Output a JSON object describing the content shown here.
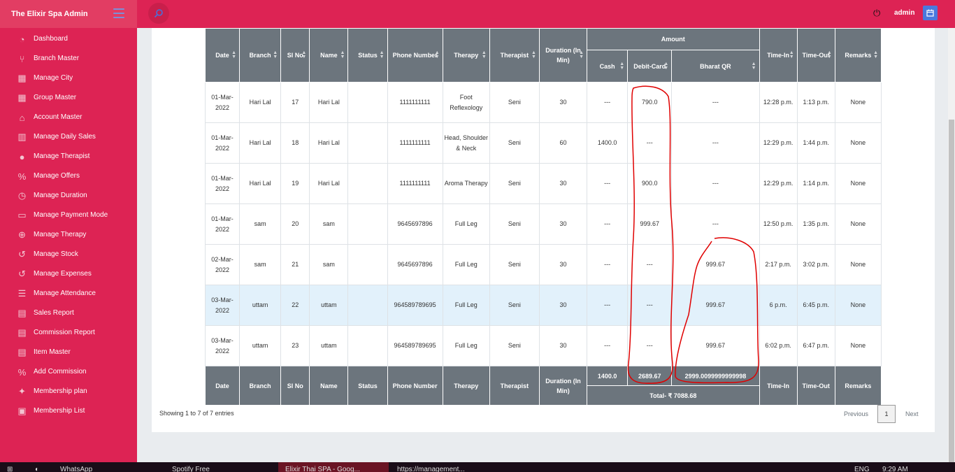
{
  "app": {
    "brand": "The Elixir Spa Admin",
    "user": "admin"
  },
  "colors": {
    "primary": "#dd2354",
    "header_cell": "#6c757d",
    "highlight_row": "#e2f1fb",
    "annotation": "#e00000"
  },
  "sidebar": {
    "items": [
      {
        "label": "Dashboard",
        "icon": "dashboard-icon"
      },
      {
        "label": "Branch Master",
        "icon": "branch-icon"
      },
      {
        "label": "Manage City",
        "icon": "building-icon"
      },
      {
        "label": "Group Master",
        "icon": "building-icon"
      },
      {
        "label": "Account Master",
        "icon": "bank-icon"
      },
      {
        "label": "Manage Daily Sales",
        "icon": "bar-chart-icon"
      },
      {
        "label": "Manage Therapist",
        "icon": "user-icon"
      },
      {
        "label": "Manage Offers",
        "icon": "percent-icon"
      },
      {
        "label": "Manage Duration",
        "icon": "clock-icon"
      },
      {
        "label": "Manage Payment Mode",
        "icon": "money-icon"
      },
      {
        "label": "Manage Therapy",
        "icon": "plus-circle-icon"
      },
      {
        "label": "Manage Stock",
        "icon": "history-icon"
      },
      {
        "label": "Manage Expenses",
        "icon": "history-icon"
      },
      {
        "label": "Manage Attendance",
        "icon": "list-icon"
      },
      {
        "label": "Sales Report",
        "icon": "file-icon"
      },
      {
        "label": "Commission Report",
        "icon": "file-icon"
      },
      {
        "label": "Item Master",
        "icon": "file-icon"
      },
      {
        "label": "Add Commission",
        "icon": "percent-icon"
      },
      {
        "label": "Membership plan",
        "icon": "handshake-icon"
      },
      {
        "label": "Membership List",
        "icon": "user-card-icon"
      }
    ]
  },
  "table": {
    "headers": {
      "date": "Date",
      "branch": "Branch",
      "sl": "Sl No",
      "name": "Name",
      "status": "Status",
      "phone": "Phone Number",
      "therapy": "Therapy",
      "therapist": "Therapist",
      "duration": "Duration (In Min)",
      "amount": "Amount",
      "cash": "Cash",
      "debit": "Debit-Card",
      "bharat": "Bharat QR",
      "time_in": "Time-In",
      "time_out": "Time-Out",
      "remarks": "Remarks"
    },
    "rows": [
      {
        "date": "01-Mar-2022",
        "branch": "Hari Lal",
        "sl": "17",
        "name": "Hari Lal",
        "status": "",
        "phone": "1111111111",
        "therapy": "Foot Reflexology",
        "therapist": "Seni",
        "duration": "30",
        "cash": "---",
        "debit": "790.0",
        "bharat": "---",
        "time_in": "12:28 p.m.",
        "time_out": "1:13 p.m.",
        "remarks": "None"
      },
      {
        "date": "01-Mar-2022",
        "branch": "Hari Lal",
        "sl": "18",
        "name": "Hari Lal",
        "status": "",
        "phone": "1111111111",
        "therapy": "Head, Shoulder & Neck",
        "therapist": "Seni",
        "duration": "60",
        "cash": "1400.0",
        "debit": "---",
        "bharat": "---",
        "time_in": "12:29 p.m.",
        "time_out": "1:44 p.m.",
        "remarks": "None"
      },
      {
        "date": "01-Mar-2022",
        "branch": "Hari Lal",
        "sl": "19",
        "name": "Hari Lal",
        "status": "",
        "phone": "1111111111",
        "therapy": "Aroma Therapy",
        "therapist": "Seni",
        "duration": "30",
        "cash": "---",
        "debit": "900.0",
        "bharat": "---",
        "time_in": "12:29 p.m.",
        "time_out": "1:14 p.m.",
        "remarks": "None"
      },
      {
        "date": "01-Mar-2022",
        "branch": "sam",
        "sl": "20",
        "name": "sam",
        "status": "",
        "phone": "9645697896",
        "therapy": "Full Leg",
        "therapist": "Seni",
        "duration": "30",
        "cash": "---",
        "debit": "999.67",
        "bharat": "---",
        "time_in": "12:50 p.m.",
        "time_out": "1:35 p.m.",
        "remarks": "None"
      },
      {
        "date": "02-Mar-2022",
        "branch": "sam",
        "sl": "21",
        "name": "sam",
        "status": "",
        "phone": "9645697896",
        "therapy": "Full Leg",
        "therapist": "Seni",
        "duration": "30",
        "cash": "---",
        "debit": "---",
        "bharat": "999.67",
        "time_in": "2:17 p.m.",
        "time_out": "3:02 p.m.",
        "remarks": "None"
      },
      {
        "date": "03-Mar-2022",
        "branch": "uttam",
        "sl": "22",
        "name": "uttam",
        "status": "",
        "phone": "964589789695",
        "therapy": "Full Leg",
        "therapist": "Seni",
        "duration": "30",
        "cash": "---",
        "debit": "---",
        "bharat": "999.67",
        "time_in": "6 p.m.",
        "time_out": "6:45 p.m.",
        "remarks": "None"
      },
      {
        "date": "03-Mar-2022",
        "branch": "uttam",
        "sl": "23",
        "name": "uttam",
        "status": "",
        "phone": "964589789695",
        "therapy": "Full Leg",
        "therapist": "Seni",
        "duration": "30",
        "cash": "---",
        "debit": "---",
        "bharat": "999.67",
        "time_in": "6:02 p.m.",
        "time_out": "6:47 p.m.",
        "remarks": "None"
      }
    ],
    "footer": {
      "cash_total": "1400.0",
      "debit_total": "2689.67",
      "bharat_total": "2999.0099999999998",
      "grand_total": "Total- ₹ 7088.68"
    }
  },
  "pagination": {
    "info": "Showing 1 to 7 of 7 entries",
    "previous": "Previous",
    "current": "1",
    "next": "Next"
  },
  "taskbar": {
    "items": [
      "WhatsApp",
      "Spotify Free",
      "Elixir Thai SPA - Goog...",
      "https://management..."
    ],
    "lang": "ENG",
    "time": "9:29 AM"
  }
}
